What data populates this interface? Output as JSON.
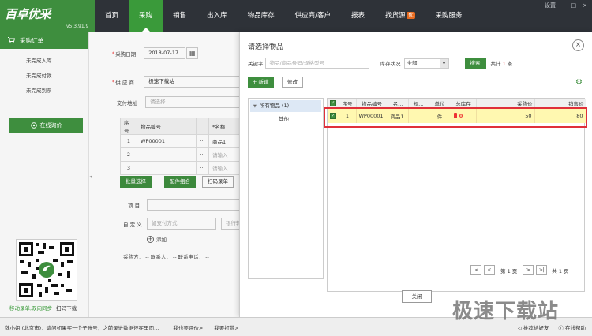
{
  "app": {
    "brand": "百卓优采",
    "version": "v5.3.91.9"
  },
  "nav": [
    "首页",
    "采购",
    "销售",
    "出入库",
    "物品库存",
    "供应商/客户",
    "报表",
    "找货源",
    "采购服务"
  ],
  "nav_badge": "优",
  "window_controls": {
    "settings": "设置",
    "min": "–",
    "max": "□",
    "close": "×"
  },
  "sidebar": {
    "header": "采购订单",
    "items": [
      "未完成入库",
      "未完成付款",
      "未完成到票"
    ],
    "inquiry_button": "在线询价",
    "footer_a": "移动录单,双向同步",
    "footer_b": "扫码下载"
  },
  "form": {
    "date_label": "采购日期",
    "date_value": "2018-07-17",
    "supplier_label": "供 应 商",
    "supplier_value": "极速下载站",
    "address_label": "交付地址",
    "address_placeholder": "请选择",
    "table_headers": [
      "序号",
      "物品编号",
      "",
      "*名称"
    ],
    "rows": [
      {
        "no": "1",
        "code": "WP00001",
        "more": "···",
        "name": "商品1"
      },
      {
        "no": "2",
        "code": "",
        "more": "···",
        "name": "请输入"
      },
      {
        "no": "3",
        "code": "",
        "more": "···",
        "name": "请输入"
      }
    ],
    "btn_batch": "批量选择",
    "btn_combo": "配件组合",
    "btn_scan": "扫码录单",
    "project_label": "项 目",
    "custom_label": "自 定 义",
    "custom_ph1": "如支付方式",
    "custom_ph2": "银行转账",
    "add_label": "添加",
    "footer_info": "采购方： --    联系人： --    联系电话： --"
  },
  "dialog": {
    "title": "请选择物品",
    "keyword_label": "关键字",
    "keyword_placeholder": "物品/商品条码/规格型号",
    "stock_label": "库存状况",
    "stock_value": "全部",
    "search_btn": "搜索",
    "total_prefix": "共计",
    "total_count": "1",
    "total_suffix": "条",
    "new_btn": "+ 新建",
    "edit_btn": "修改",
    "tree_root": "所有物品 (1)",
    "tree_child": "其他",
    "headers": [
      "",
      "序号",
      "物品编号",
      "名...",
      "规...",
      "单位",
      "总库存",
      "采购价",
      "销售价"
    ],
    "rows": [
      {
        "no": "1",
        "code": "WP00001",
        "name": "商品1",
        "spec": "",
        "unit": "件",
        "stock": "0",
        "buy": "50",
        "sell": "80"
      }
    ],
    "stock_badge": "!",
    "pager": {
      "first": "|<",
      "prev": "<",
      "page_label": "第 1 页",
      "next": ">",
      "last": ">|",
      "total_pages": "共 1 页"
    },
    "close_btn": "关闭"
  },
  "status": {
    "name": "魏小姐 (北京市)",
    "msg": "：请问如果买一个子账号，之前录进数据还在里面...",
    "eval": "我也要评价>",
    "reward": "我要打赏>",
    "recommend": "推荐给好友",
    "help": "在线帮助"
  },
  "watermark": "极速下载站",
  "colors": {
    "brand_green": "#3e8e3e",
    "topbar": "#2e3238",
    "highlight_red": "#e0303a",
    "selected_row": "#fff8b0"
  }
}
